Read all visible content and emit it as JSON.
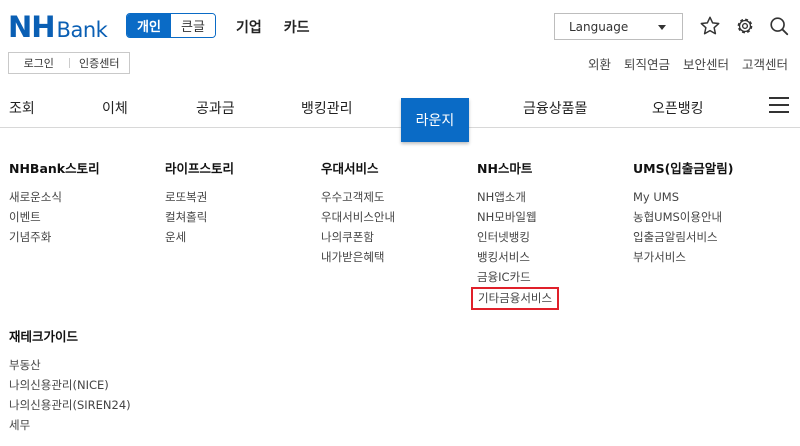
{
  "header": {
    "logo_nh": "NH",
    "logo_bank": "Bank",
    "segment": {
      "active": "개인",
      "inactive": "큰글"
    },
    "top_links": [
      "기업",
      "카드"
    ],
    "language": "Language",
    "icons": [
      "star-icon",
      "gear-icon",
      "search-icon"
    ]
  },
  "auth": {
    "login": "로그인",
    "cert_center": "인증센터"
  },
  "util_links": [
    "외환",
    "퇴직연금",
    "보안센터",
    "고객센터"
  ],
  "gnb": {
    "items": [
      "조회",
      "이체",
      "공과금",
      "뱅킹관리",
      "라운지",
      "금융상품몰",
      "오픈뱅킹"
    ],
    "active": "라운지"
  },
  "menu": {
    "columns": [
      {
        "title": "NHBank스토리",
        "items": [
          "새로운소식",
          "이벤트",
          "기념주화"
        ]
      },
      {
        "title": "라이프스토리",
        "items": [
          "로또복권",
          "컬쳐홀릭",
          "운세"
        ]
      },
      {
        "title": "우대서비스",
        "items": [
          "우수고객제도",
          "우대서비스안내",
          "나의쿠폰함",
          "내가받은혜택"
        ]
      },
      {
        "title": "NH스마트",
        "items": [
          "NH앱소개",
          "NH모바일웹",
          "인터넷뱅킹",
          "뱅킹서비스",
          "금융IC카드",
          "기타금융서비스"
        ]
      },
      {
        "title": "UMS(입출금알림)",
        "items": [
          "My UMS",
          "농협UMS이용안내",
          "입출금알림서비스",
          "부가서비스"
        ]
      },
      {
        "title": "재테크가이드",
        "items": [
          "부동산",
          "나의신용관리(NICE)",
          "나의신용관리(SIREN24)",
          "세무"
        ]
      }
    ]
  },
  "colors": {
    "brand": "#0a6bc6",
    "highlight": "#e0202a"
  }
}
